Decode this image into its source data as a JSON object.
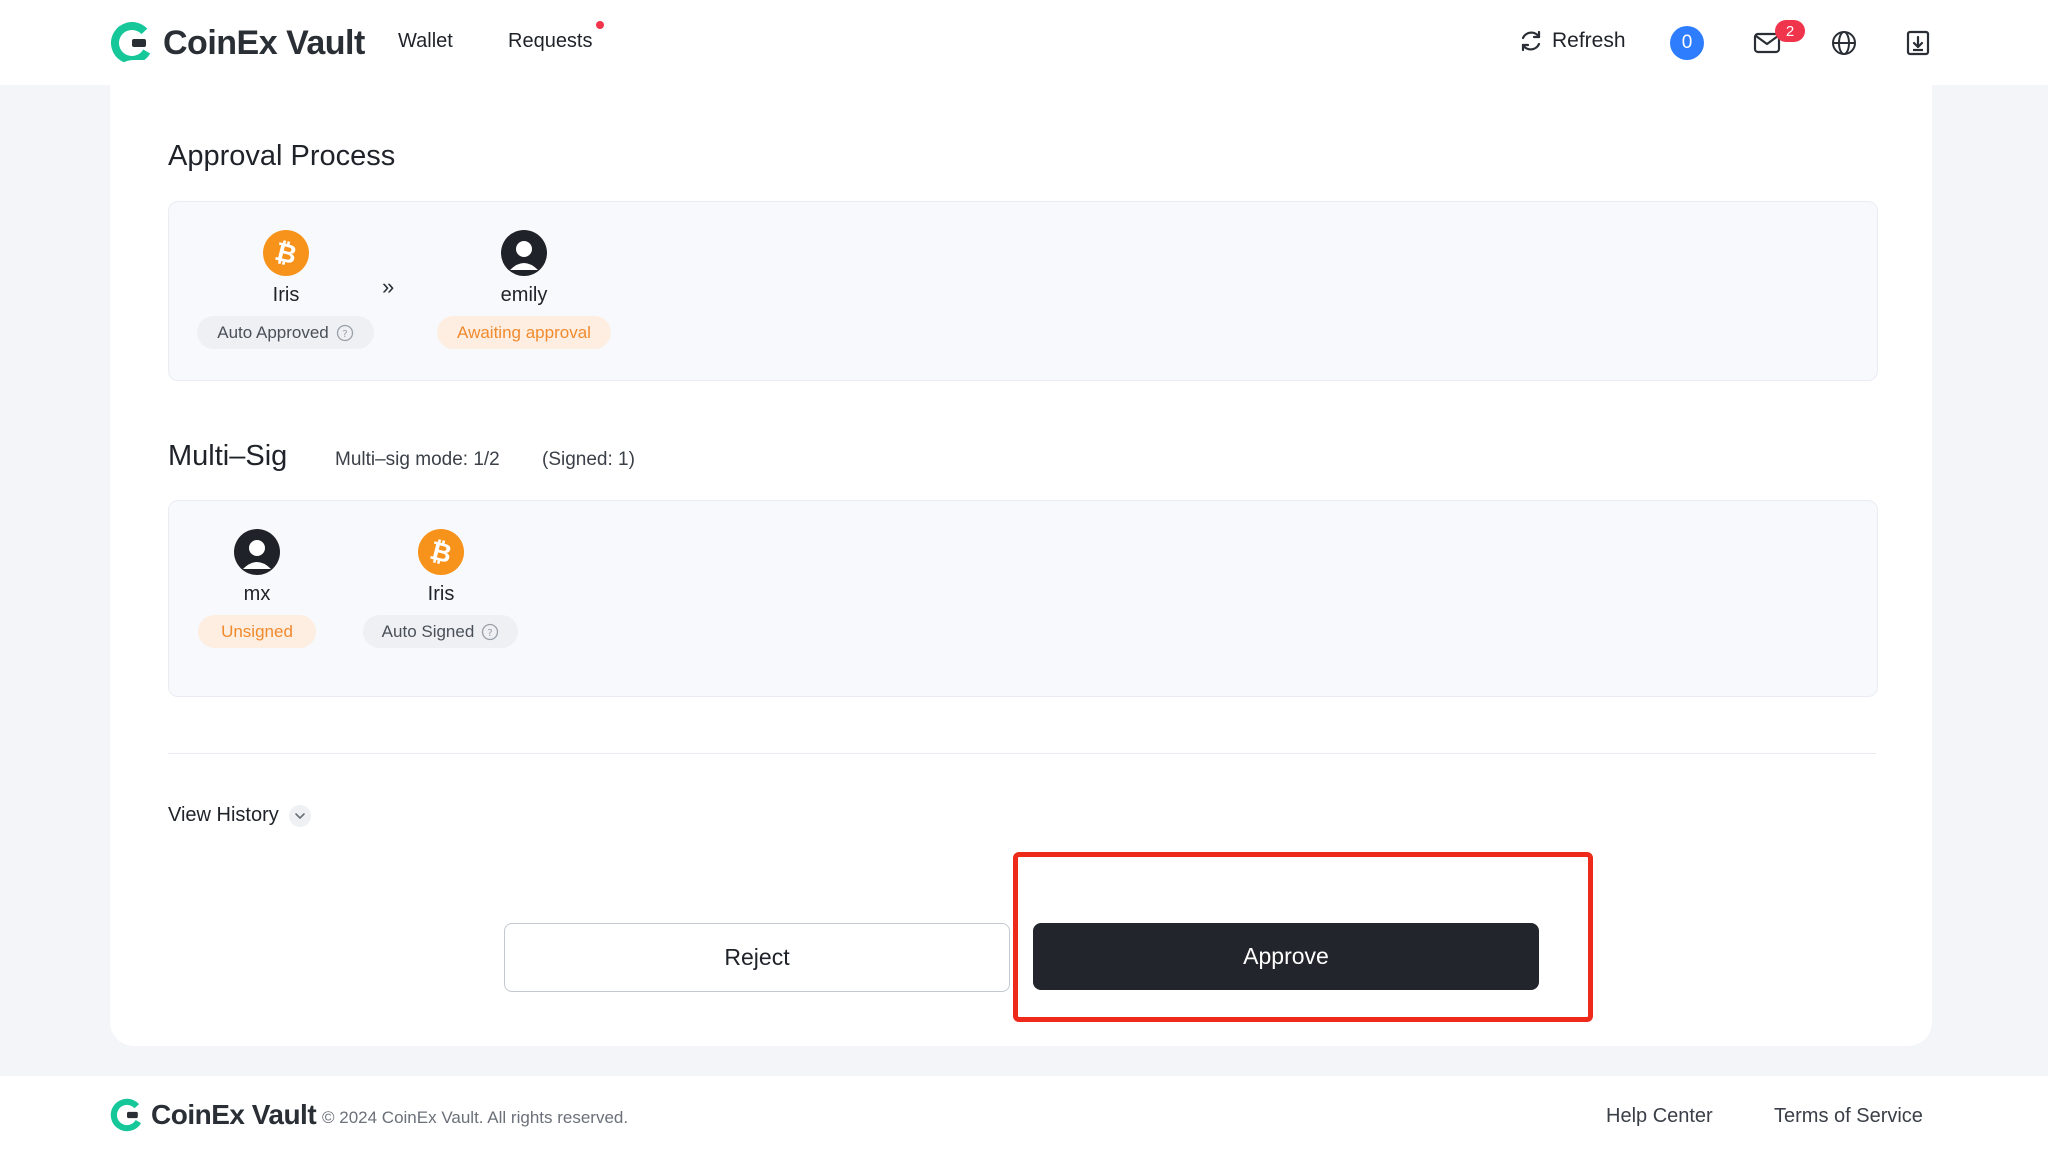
{
  "header": {
    "brand": "CoinEx Vault",
    "nav": {
      "wallet": "Wallet",
      "requests": "Requests"
    },
    "refresh": "Refresh",
    "count_badge": "0",
    "mail_badge": "2"
  },
  "approval": {
    "title": "Approval Process",
    "steps": [
      {
        "name": "Iris",
        "status": "Auto Approved"
      },
      {
        "name": "emily",
        "status": "Awaiting approval"
      }
    ],
    "arrow": "»"
  },
  "multisig": {
    "title": "Multi–Sig",
    "mode": "Multi–sig mode: 1/2",
    "signed": "(Signed: 1)",
    "signers": [
      {
        "name": "mx",
        "status": "Unsigned"
      },
      {
        "name": "Iris",
        "status": "Auto Signed"
      }
    ]
  },
  "history": {
    "label": "View History"
  },
  "actions": {
    "reject": "Reject",
    "approve": "Approve"
  },
  "footer": {
    "brand": "CoinEx Vault",
    "copyright": "© 2024 CoinEx Vault. All rights reserved.",
    "help": "Help Center",
    "terms": "Terms of Service"
  },
  "colors": {
    "accent_green": "#16c79a",
    "badge_blue": "#2e7dff",
    "badge_red": "#f0344c",
    "btc_orange": "#f7931a",
    "highlight_red": "#ee2a1b"
  }
}
